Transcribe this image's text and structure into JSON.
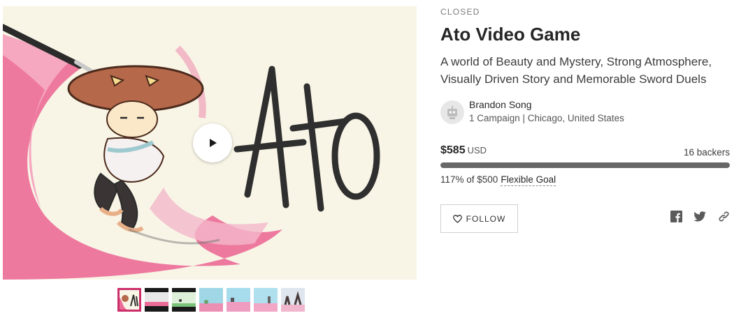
{
  "project": {
    "status": "CLOSED",
    "title": "Ato Video Game",
    "blurb_line1": "A world of Beauty and Mystery, Strong Atmosphere,",
    "blurb_line2": "Visually Driven Story and Memorable Sword Duels"
  },
  "creator": {
    "name": "Brandon Song",
    "meta": "1 Campaign | Chicago, United States",
    "avatar_icon": "robot-avatar-icon"
  },
  "funding": {
    "amount": "$585",
    "currency": "USD",
    "backers": "16 backers",
    "percent_text": "117% of $500",
    "goal_type": "Flexible Goal",
    "progress_percent": 100
  },
  "actions": {
    "follow_label": "FOLLOW",
    "follow_icon": "heart-outline-icon",
    "share_icons": [
      "facebook-icon",
      "twitter-icon",
      "link-icon"
    ]
  },
  "media": {
    "play_icon": "play-icon",
    "title_art_text": "Ato",
    "thumbnail_count": 7,
    "active_thumbnail": 0
  },
  "colors": {
    "accent_pink": "#cc2e6a",
    "progress_fill": "#676767",
    "progress_track": "#e0e0e0"
  }
}
